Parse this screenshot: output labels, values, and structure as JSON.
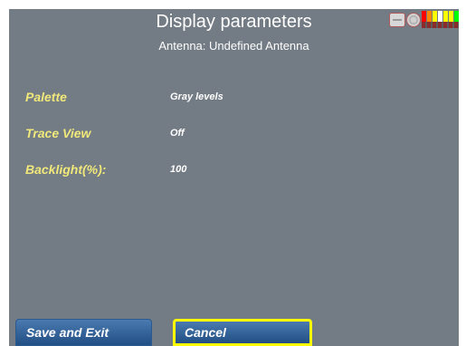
{
  "header": {
    "title": "Display parameters",
    "subtitle": "Antenna: Undefined Antenna"
  },
  "status": {
    "icons": [
      "battery-icon",
      "gauge-icon",
      "signal-level-icon"
    ],
    "signal_colors": [
      "#ff0000",
      "#ff8800",
      "#ffff00",
      "#ffffff",
      "#ffff00",
      "#ffff00",
      "#00ff00"
    ]
  },
  "params": [
    {
      "label": "Palette",
      "value": "Gray levels"
    },
    {
      "label": "Trace View",
      "value": "Off"
    },
    {
      "label": "Backlight(%):",
      "value": "100"
    }
  ],
  "buttons": {
    "save_label": "Save and Exit",
    "cancel_label": "Cancel"
  },
  "colors": {
    "background": "#737b84",
    "label": "#f0e87a",
    "value": "#ffffff",
    "button": "#2a5a90",
    "focus_border": "#ffff00"
  }
}
